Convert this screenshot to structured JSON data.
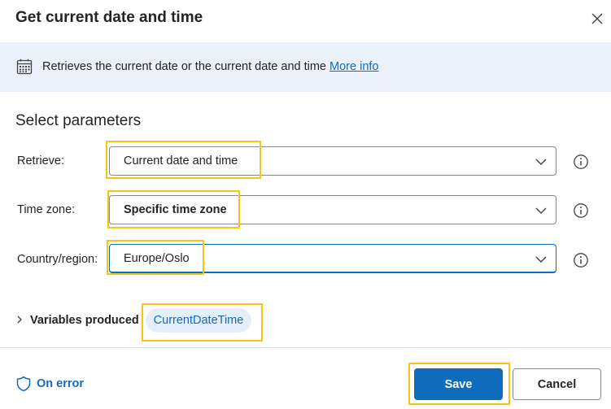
{
  "dialog": {
    "title": "Get current date and time",
    "close_icon": "close-icon"
  },
  "info_bar": {
    "icon": "calendar-icon",
    "text": "Retrieves the current date or the current date and time",
    "link": "More info"
  },
  "section_title": "Select parameters",
  "params": [
    {
      "label": "Retrieve:",
      "value": "Current date and time",
      "bold": false
    },
    {
      "label": "Time zone:",
      "value": "Specific time zone",
      "bold": true
    },
    {
      "label": "Country/region:",
      "value": "Europe/Oslo",
      "bold": false
    }
  ],
  "variables": {
    "label": "Variables produced",
    "chip": "CurrentDateTime"
  },
  "footer": {
    "on_error": "On error",
    "save": "Save",
    "cancel": "Cancel"
  },
  "colors": {
    "accent": "#0f6cbd",
    "info_bar_bg": "#eaf1fb",
    "highlight": "#f5c518"
  }
}
